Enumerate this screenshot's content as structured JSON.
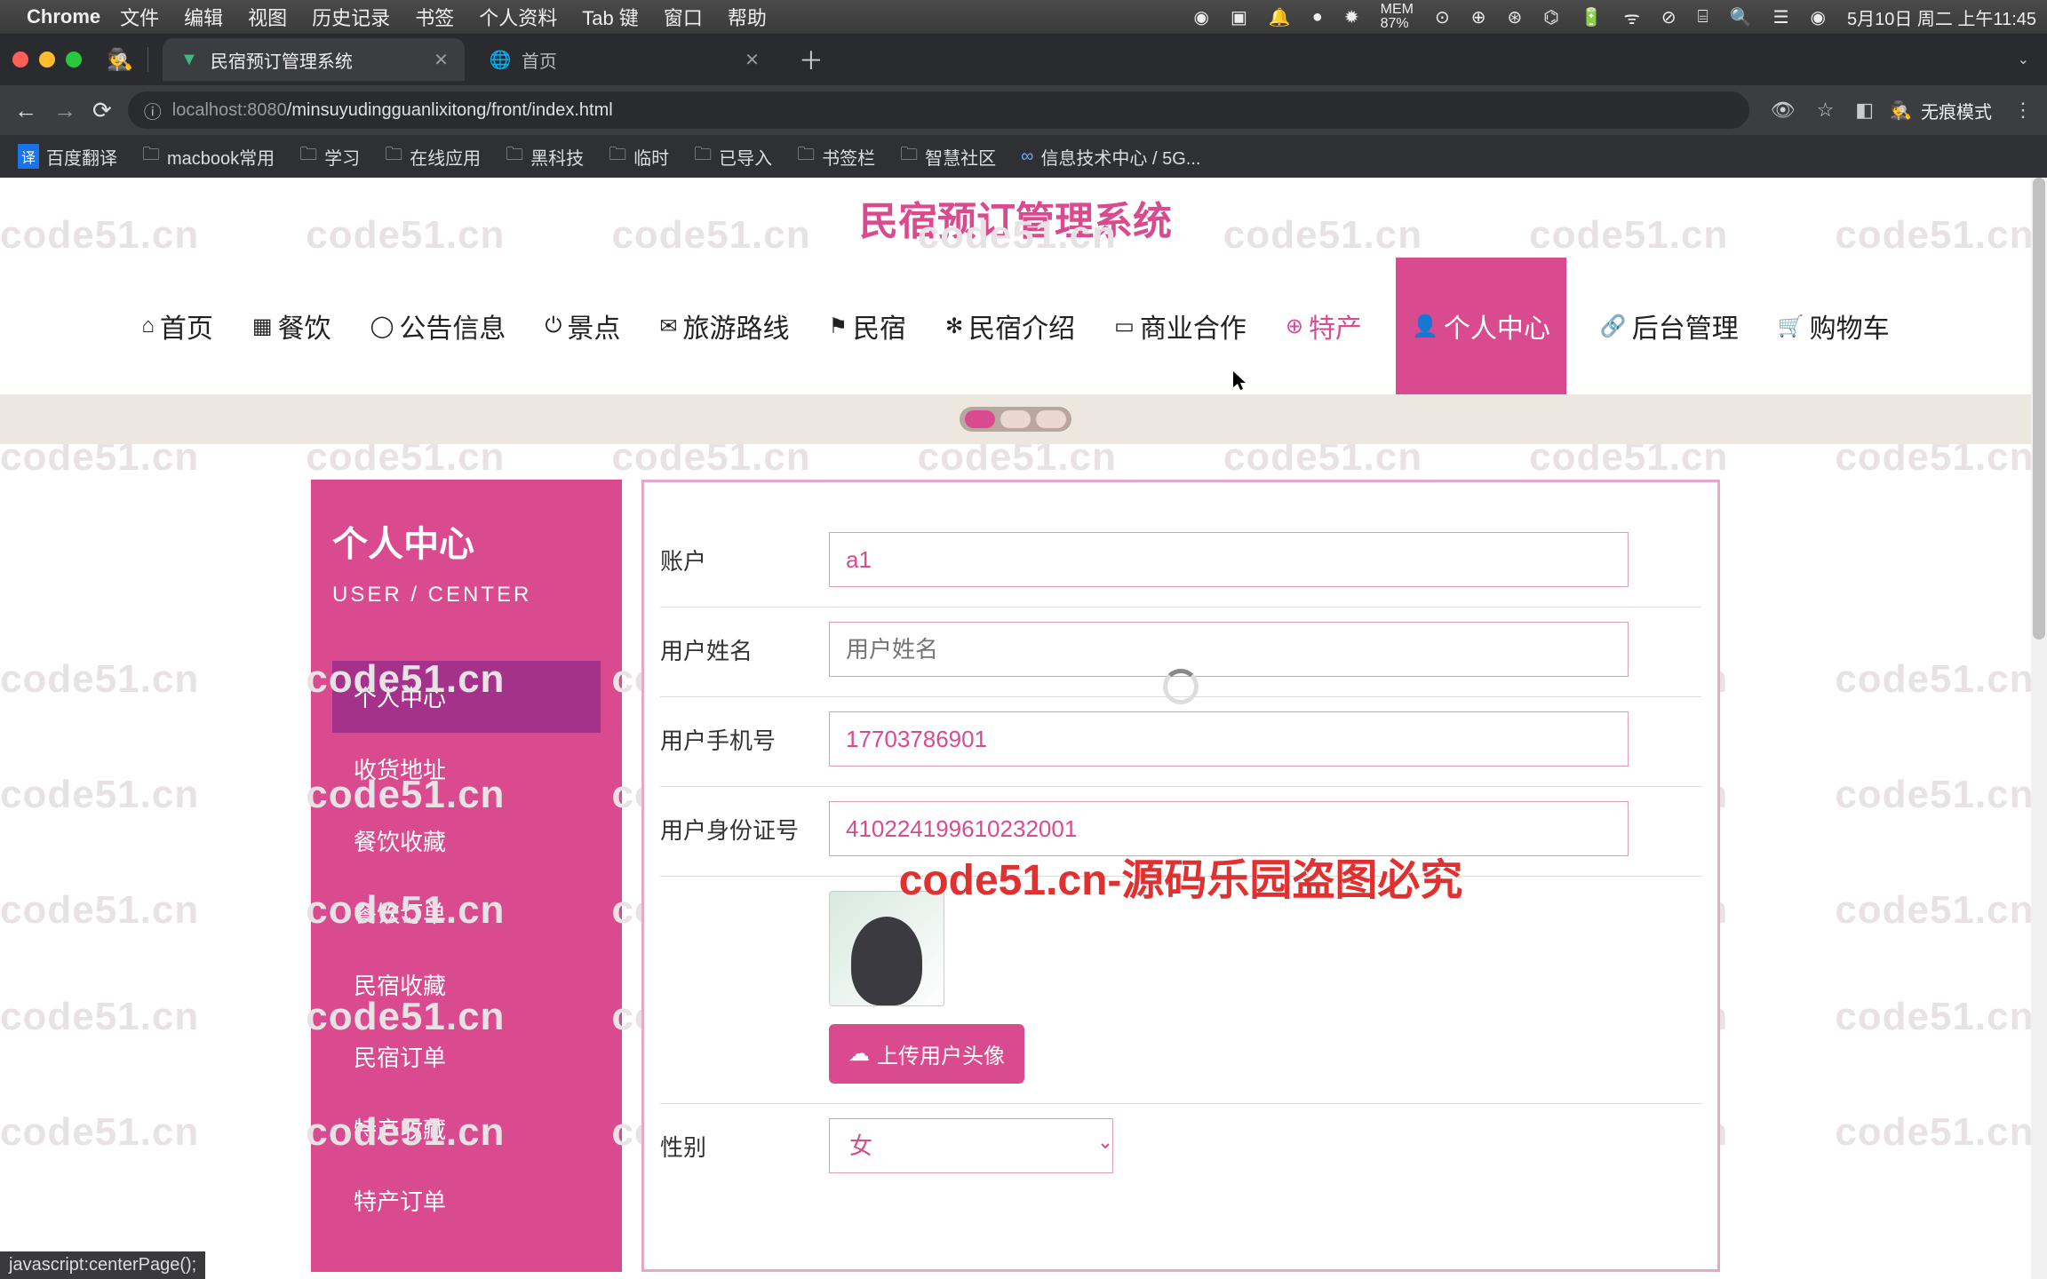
{
  "menubar": {
    "app": "Chrome",
    "items": [
      "文件",
      "编辑",
      "视图",
      "历史记录",
      "书签",
      "个人资料",
      "Tab 键",
      "窗口",
      "帮助"
    ],
    "clock": "5月10日 周二 上午11:45",
    "mem": "87%"
  },
  "tabs": [
    {
      "title": "民宿预订管理系统",
      "active": true
    },
    {
      "title": "首页",
      "active": false
    }
  ],
  "address": {
    "host": "localhost",
    "port": ":8080",
    "path": "/minsuyudingguanlixitong/front/index.html"
  },
  "incognito": "无痕模式",
  "bookmarks": [
    "百度翻译",
    "macbook常用",
    "学习",
    "在线应用",
    "黑科技",
    "临时",
    "已导入",
    "书签栏",
    "智慧社区",
    "信息技术中心 / 5G..."
  ],
  "site": {
    "title": "民宿预订管理系统"
  },
  "nav": [
    "首页",
    "餐饮",
    "公告信息",
    "景点",
    "旅游路线",
    "民宿",
    "民宿介绍",
    "商业合作",
    "特产",
    "个人中心",
    "后台管理",
    "购物车"
  ],
  "sidebar": {
    "title": "个人中心",
    "subtitle": "USER / CENTER",
    "items": [
      "个人中心",
      "收货地址",
      "餐饮收藏",
      "餐饮订单",
      "民宿收藏",
      "民宿订单",
      "特产收藏",
      "特产订单"
    ]
  },
  "form": {
    "account_label": "账户",
    "account_value": "a1",
    "name_label": "用户姓名",
    "name_placeholder": "用户姓名",
    "phone_label": "用户手机号",
    "phone_value": "17703786901",
    "idcard_label": "用户身份证号",
    "idcard_value": "410224199610232001",
    "upload_label": "上传用户头像",
    "gender_label": "性别",
    "gender_value": "女"
  },
  "watermark_text": "code51.cn",
  "watermark_center": "code51.cn-源码乐园盗图必究",
  "status": "javascript:centerPage();"
}
